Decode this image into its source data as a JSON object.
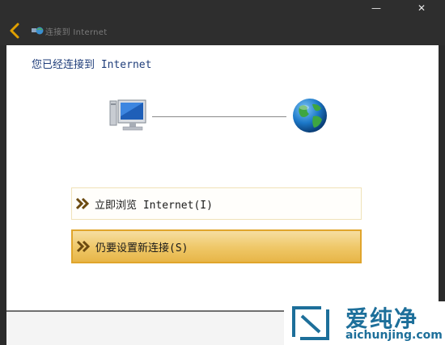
{
  "window": {
    "title": "连接到 Internet",
    "minimize_glyph": "—",
    "close_glyph": "✕"
  },
  "status": {
    "heading": "您已经连接到 Internet"
  },
  "diagram": {
    "left_icon": "computer-icon",
    "right_icon": "globe-icon"
  },
  "options": [
    {
      "label": "立即浏览 Internet(I)",
      "icon": "double-chevron-icon"
    },
    {
      "label": "仍要设置新连接(S)",
      "icon": "double-chevron-icon"
    }
  ],
  "watermark": {
    "brand": "爱纯净",
    "url": "aichunjing.com"
  },
  "colors": {
    "accent": "#e0a000",
    "heading": "#1f3d7a",
    "selected_fill": "#efc869",
    "selected_border": "#e0a52c",
    "watermark": "#1d6f9a"
  }
}
